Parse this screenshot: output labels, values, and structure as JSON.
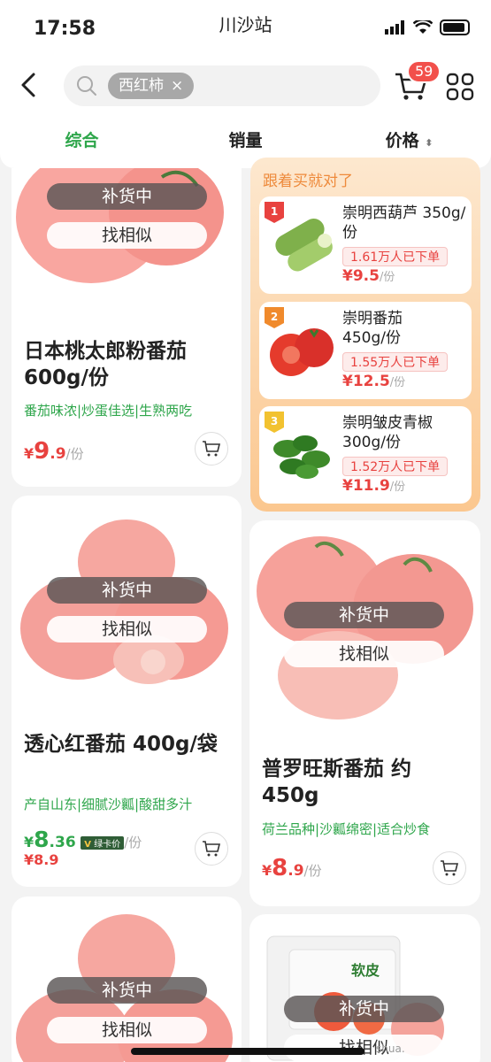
{
  "status": {
    "time": "17:58",
    "location": "川沙站"
  },
  "header": {
    "search_chip": "西红柿",
    "cart_count": "59"
  },
  "tabs": [
    {
      "label": "综合"
    },
    {
      "label": "销量"
    },
    {
      "label": "价格"
    }
  ],
  "products": [
    {
      "restock": "补货中",
      "similar": "找相似",
      "title": "日本桃太郎粉番茄 600g/份",
      "tags": "番茄味浓|炒蛋佳选|生熟两吃",
      "price_cur": "¥",
      "price_int": "9",
      "price_dec": ".9",
      "price_unit": "/份"
    },
    {
      "restock": "补货中",
      "similar": "找相似",
      "title": "透心红番茄 400g/袋",
      "tags": "产自山东|细腻沙瓤|酸甜多汁",
      "vip_cur": "¥",
      "vip_int": "8",
      "vip_dec": ".36",
      "vip_v": "V",
      "vip_label": "绿卡价",
      "vip_unit": "/份",
      "orig_price": "¥8.9"
    },
    {
      "restock": "补货中",
      "similar": "找相似",
      "title": "普罗旺斯番茄 约450g",
      "tags": "荷兰品种|沙瓤绵密|适合炒食",
      "price_cur": "¥",
      "price_int": "8",
      "price_dec": ".9",
      "price_unit": "/份"
    },
    {
      "restock": "补货中",
      "similar": "找相似"
    },
    {
      "restock": "补货中",
      "similar": "找相似",
      "pack_text": "软皮"
    }
  ],
  "ranking": {
    "title": "跟着买就对了",
    "items": [
      {
        "rank": "1",
        "name": "崇明西葫芦 350g/份",
        "sold": "1.61万人已下单",
        "price": "¥9.5",
        "unit": "/份"
      },
      {
        "rank": "2",
        "name": "崇明番茄 450g/份",
        "sold": "1.55万人已下单",
        "price": "¥12.5",
        "unit": "/份"
      },
      {
        "rank": "3",
        "name": "崇明皱皮青椒 300g/份",
        "sold": "1.52万人已下单",
        "price": "¥11.9",
        "unit": "/份"
      }
    ]
  },
  "watermark": "shua.",
  "colors": {
    "accent": "#2ea64b",
    "price": "#e8423f",
    "badge": "#f2504b"
  }
}
